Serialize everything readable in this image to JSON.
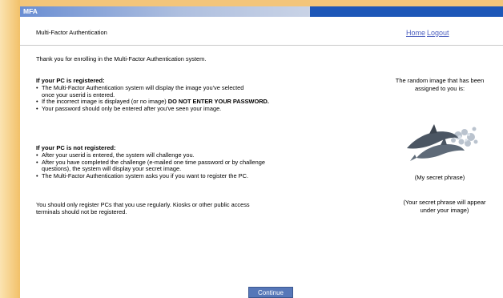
{
  "window": {
    "title": "MFA"
  },
  "header": {
    "app_name": "Multi-Factor Authentication",
    "nav": {
      "home": "Home",
      "logout": "Logout"
    }
  },
  "intro": "Thank you for enrolling in the Multi-Factor Authentication system.",
  "registered": {
    "heading": "If your PC is registered:",
    "bullets": [
      {
        "line1": "The Multi-Factor Authentication system will display the image you've selected",
        "line2": "once your userid is entered."
      },
      {
        "text": "If the incorrect image is displayed (or no image) ",
        "bold": "DO NOT ENTER YOUR PASSWORD."
      },
      {
        "text": "Your password should only be entered after you've seen your image."
      }
    ]
  },
  "not_registered": {
    "heading": "If your PC is not registered:",
    "bullets": [
      {
        "text": "After your userid is entered, the system will challenge you."
      },
      {
        "line1": "After you have completed the challenge (e-mailed one time password or by challenge",
        "line2": "questions), the system will display your secret image."
      },
      {
        "text": "The Multi-Factor Authentication system asks you if you want to register the PC."
      }
    ]
  },
  "note": {
    "line1": "You should only register PCs that you use regularly.  Kiosks or other public access",
    "line2": "terminals should not be registered."
  },
  "right_panel": {
    "image_caption_line1": "The random image that has been",
    "image_caption_line2": "assigned to you is:",
    "image_icon": "dolphin-image",
    "secret_phrase": "(My secret phrase)",
    "phrase_note_line1": "(Your secret phrase will appear",
    "phrase_note_line2": "under your image)"
  },
  "continue_label": "Continue",
  "colors": {
    "titlebar": "#1d57b8",
    "link": "#4c5fbf",
    "button": "#5677b8",
    "page_bg": "#f3c57a"
  }
}
